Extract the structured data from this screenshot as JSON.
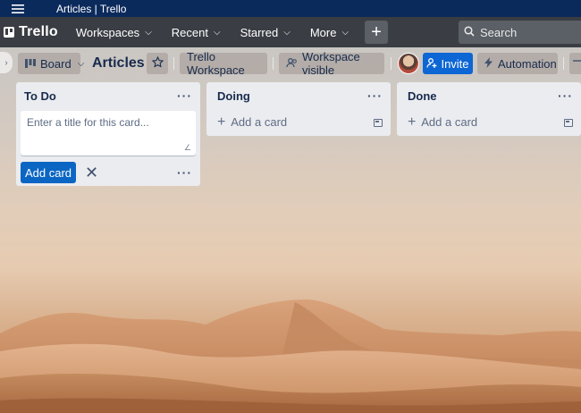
{
  "window": {
    "title": "Articles | Trello"
  },
  "header": {
    "logo_text": "Trello",
    "nav": [
      {
        "label": "Workspaces"
      },
      {
        "label": "Recent"
      },
      {
        "label": "Starred"
      },
      {
        "label": "More"
      }
    ],
    "create_symbol": "+",
    "search_label": "Search"
  },
  "board": {
    "view_label": "Board",
    "title": "Articles",
    "workspace_label": "Trello Workspace",
    "visibility_label": "Workspace visible",
    "invite_label": "Invite",
    "automation_label": "Automation"
  },
  "lists": [
    {
      "title": "To Do",
      "composer_placeholder": "Enter a title for this card...",
      "add_button": "Add card"
    },
    {
      "title": "Doing",
      "add_label": "Add a card"
    },
    {
      "title": "Done",
      "add_label": "Add a card"
    }
  ],
  "colors": {
    "titlebar": "#0b2a5c",
    "appbar": "#3a3d43",
    "accent_blue": "#0c66d4",
    "list_bg": "#ebecf0"
  }
}
